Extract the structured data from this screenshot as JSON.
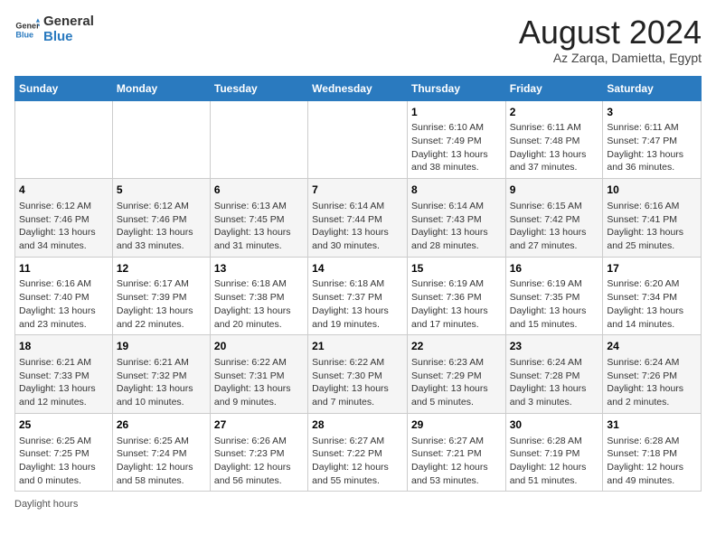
{
  "header": {
    "logo_general": "General",
    "logo_blue": "Blue",
    "title": "August 2024",
    "subtitle": "Az Zarqa, Damietta, Egypt"
  },
  "days_of_week": [
    "Sunday",
    "Monday",
    "Tuesday",
    "Wednesday",
    "Thursday",
    "Friday",
    "Saturday"
  ],
  "weeks": [
    [
      {
        "num": "",
        "info": ""
      },
      {
        "num": "",
        "info": ""
      },
      {
        "num": "",
        "info": ""
      },
      {
        "num": "",
        "info": ""
      },
      {
        "num": "1",
        "info": "Sunrise: 6:10 AM\nSunset: 7:49 PM\nDaylight: 13 hours and 38 minutes."
      },
      {
        "num": "2",
        "info": "Sunrise: 6:11 AM\nSunset: 7:48 PM\nDaylight: 13 hours and 37 minutes."
      },
      {
        "num": "3",
        "info": "Sunrise: 6:11 AM\nSunset: 7:47 PM\nDaylight: 13 hours and 36 minutes."
      }
    ],
    [
      {
        "num": "4",
        "info": "Sunrise: 6:12 AM\nSunset: 7:46 PM\nDaylight: 13 hours and 34 minutes."
      },
      {
        "num": "5",
        "info": "Sunrise: 6:12 AM\nSunset: 7:46 PM\nDaylight: 13 hours and 33 minutes."
      },
      {
        "num": "6",
        "info": "Sunrise: 6:13 AM\nSunset: 7:45 PM\nDaylight: 13 hours and 31 minutes."
      },
      {
        "num": "7",
        "info": "Sunrise: 6:14 AM\nSunset: 7:44 PM\nDaylight: 13 hours and 30 minutes."
      },
      {
        "num": "8",
        "info": "Sunrise: 6:14 AM\nSunset: 7:43 PM\nDaylight: 13 hours and 28 minutes."
      },
      {
        "num": "9",
        "info": "Sunrise: 6:15 AM\nSunset: 7:42 PM\nDaylight: 13 hours and 27 minutes."
      },
      {
        "num": "10",
        "info": "Sunrise: 6:16 AM\nSunset: 7:41 PM\nDaylight: 13 hours and 25 minutes."
      }
    ],
    [
      {
        "num": "11",
        "info": "Sunrise: 6:16 AM\nSunset: 7:40 PM\nDaylight: 13 hours and 23 minutes."
      },
      {
        "num": "12",
        "info": "Sunrise: 6:17 AM\nSunset: 7:39 PM\nDaylight: 13 hours and 22 minutes."
      },
      {
        "num": "13",
        "info": "Sunrise: 6:18 AM\nSunset: 7:38 PM\nDaylight: 13 hours and 20 minutes."
      },
      {
        "num": "14",
        "info": "Sunrise: 6:18 AM\nSunset: 7:37 PM\nDaylight: 13 hours and 19 minutes."
      },
      {
        "num": "15",
        "info": "Sunrise: 6:19 AM\nSunset: 7:36 PM\nDaylight: 13 hours and 17 minutes."
      },
      {
        "num": "16",
        "info": "Sunrise: 6:19 AM\nSunset: 7:35 PM\nDaylight: 13 hours and 15 minutes."
      },
      {
        "num": "17",
        "info": "Sunrise: 6:20 AM\nSunset: 7:34 PM\nDaylight: 13 hours and 14 minutes."
      }
    ],
    [
      {
        "num": "18",
        "info": "Sunrise: 6:21 AM\nSunset: 7:33 PM\nDaylight: 13 hours and 12 minutes."
      },
      {
        "num": "19",
        "info": "Sunrise: 6:21 AM\nSunset: 7:32 PM\nDaylight: 13 hours and 10 minutes."
      },
      {
        "num": "20",
        "info": "Sunrise: 6:22 AM\nSunset: 7:31 PM\nDaylight: 13 hours and 9 minutes."
      },
      {
        "num": "21",
        "info": "Sunrise: 6:22 AM\nSunset: 7:30 PM\nDaylight: 13 hours and 7 minutes."
      },
      {
        "num": "22",
        "info": "Sunrise: 6:23 AM\nSunset: 7:29 PM\nDaylight: 13 hours and 5 minutes."
      },
      {
        "num": "23",
        "info": "Sunrise: 6:24 AM\nSunset: 7:28 PM\nDaylight: 13 hours and 3 minutes."
      },
      {
        "num": "24",
        "info": "Sunrise: 6:24 AM\nSunset: 7:26 PM\nDaylight: 13 hours and 2 minutes."
      }
    ],
    [
      {
        "num": "25",
        "info": "Sunrise: 6:25 AM\nSunset: 7:25 PM\nDaylight: 13 hours and 0 minutes."
      },
      {
        "num": "26",
        "info": "Sunrise: 6:25 AM\nSunset: 7:24 PM\nDaylight: 12 hours and 58 minutes."
      },
      {
        "num": "27",
        "info": "Sunrise: 6:26 AM\nSunset: 7:23 PM\nDaylight: 12 hours and 56 minutes."
      },
      {
        "num": "28",
        "info": "Sunrise: 6:27 AM\nSunset: 7:22 PM\nDaylight: 12 hours and 55 minutes."
      },
      {
        "num": "29",
        "info": "Sunrise: 6:27 AM\nSunset: 7:21 PM\nDaylight: 12 hours and 53 minutes."
      },
      {
        "num": "30",
        "info": "Sunrise: 6:28 AM\nSunset: 7:19 PM\nDaylight: 12 hours and 51 minutes."
      },
      {
        "num": "31",
        "info": "Sunrise: 6:28 AM\nSunset: 7:18 PM\nDaylight: 12 hours and 49 minutes."
      }
    ]
  ],
  "footer": {
    "note": "Daylight hours"
  }
}
